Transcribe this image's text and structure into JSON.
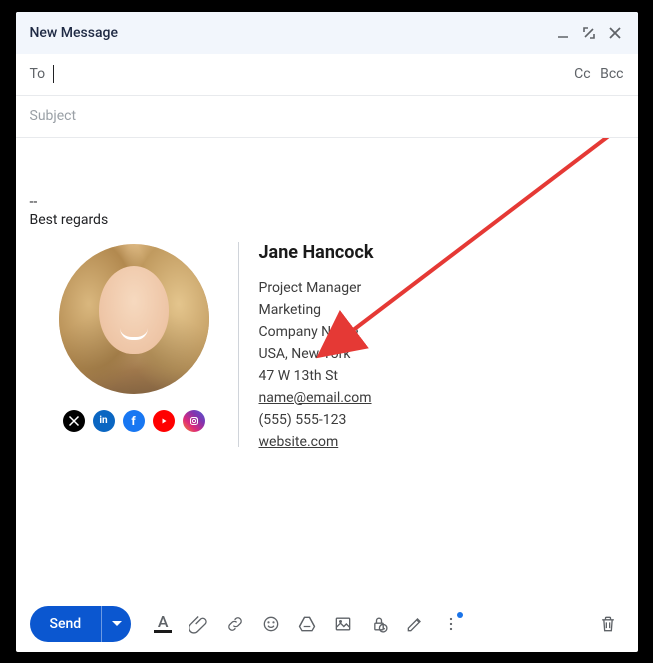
{
  "title": "New Message",
  "to": {
    "label": "To",
    "cc": "Cc",
    "bcc": "Bcc",
    "value": ""
  },
  "subject": {
    "placeholder": "Subject",
    "value": ""
  },
  "body": {
    "sep": "--",
    "regards": "Best regards"
  },
  "signature": {
    "name": "Jane Hancock",
    "title": "Project Manager",
    "department": "Marketing",
    "company": "Company Name",
    "location": "USA, New York",
    "address": "47 W 13th St",
    "email": "name@email.com",
    "phone": "(555) 555-123",
    "website": "website.com",
    "socials": [
      "x",
      "linkedin",
      "facebook",
      "youtube",
      "instagram"
    ]
  },
  "toolbar": {
    "send": "Send",
    "icons": [
      "format",
      "attach",
      "link",
      "emoji",
      "drive",
      "photo",
      "confidential",
      "signature",
      "more"
    ],
    "trash": "trash"
  },
  "arrow": {
    "color": "#e53935"
  }
}
